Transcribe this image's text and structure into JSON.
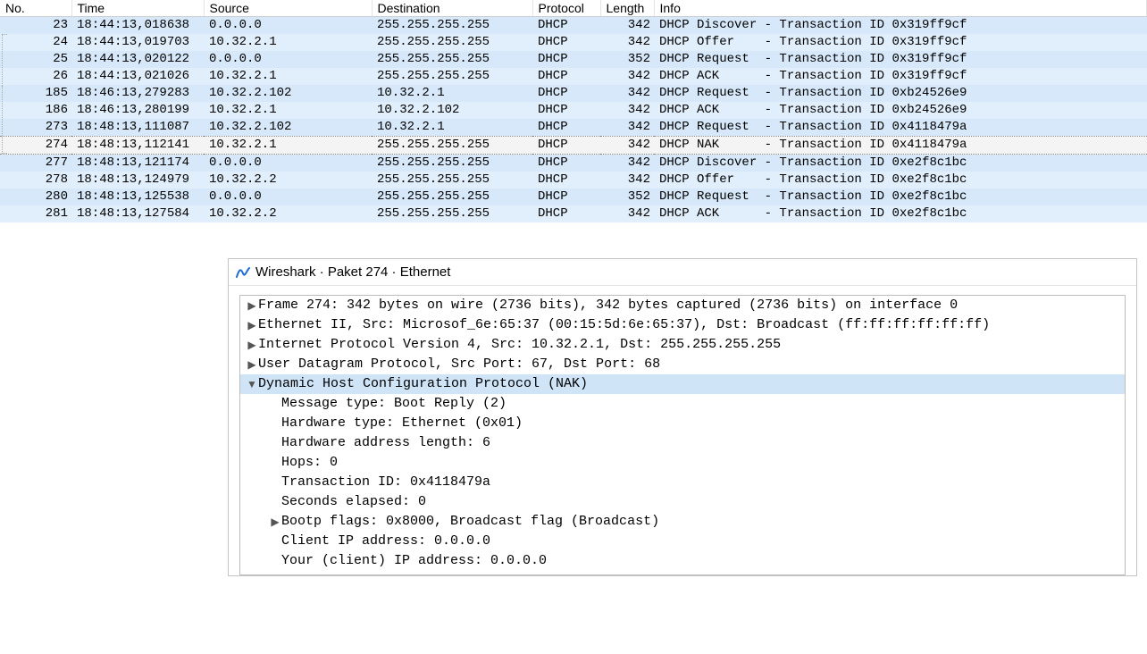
{
  "columns": {
    "no": "No.",
    "time": "Time",
    "source": "Source",
    "destination": "Destination",
    "protocol": "Protocol",
    "length": "Length",
    "info": "Info"
  },
  "packets": [
    {
      "no": "23",
      "time": "18:44:13,018638",
      "src": "0.0.0.0",
      "dst": "255.255.255.255",
      "proto": "DHCP",
      "len": "342",
      "info": "DHCP Discover - Transaction ID 0x319ff9cf",
      "alt": false,
      "sel": false
    },
    {
      "no": "24",
      "time": "18:44:13,019703",
      "src": "10.32.2.1",
      "dst": "255.255.255.255",
      "proto": "DHCP",
      "len": "342",
      "info": "DHCP Offer    - Transaction ID 0x319ff9cf",
      "alt": true,
      "sel": false
    },
    {
      "no": "25",
      "time": "18:44:13,020122",
      "src": "0.0.0.0",
      "dst": "255.255.255.255",
      "proto": "DHCP",
      "len": "352",
      "info": "DHCP Request  - Transaction ID 0x319ff9cf",
      "alt": false,
      "sel": false
    },
    {
      "no": "26",
      "time": "18:44:13,021026",
      "src": "10.32.2.1",
      "dst": "255.255.255.255",
      "proto": "DHCP",
      "len": "342",
      "info": "DHCP ACK      - Transaction ID 0x319ff9cf",
      "alt": true,
      "sel": false
    },
    {
      "no": "185",
      "time": "18:46:13,279283",
      "src": "10.32.2.102",
      "dst": "10.32.2.1",
      "proto": "DHCP",
      "len": "342",
      "info": "DHCP Request  - Transaction ID 0xb24526e9",
      "alt": false,
      "sel": false
    },
    {
      "no": "186",
      "time": "18:46:13,280199",
      "src": "10.32.2.1",
      "dst": "10.32.2.102",
      "proto": "DHCP",
      "len": "342",
      "info": "DHCP ACK      - Transaction ID 0xb24526e9",
      "alt": true,
      "sel": false
    },
    {
      "no": "273",
      "time": "18:48:13,111087",
      "src": "10.32.2.102",
      "dst": "10.32.2.1",
      "proto": "DHCP",
      "len": "342",
      "info": "DHCP Request  - Transaction ID 0x4118479a",
      "alt": false,
      "sel": false
    },
    {
      "no": "274",
      "time": "18:48:13,112141",
      "src": "10.32.2.1",
      "dst": "255.255.255.255",
      "proto": "DHCP",
      "len": "342",
      "info": "DHCP NAK      - Transaction ID 0x4118479a",
      "alt": false,
      "sel": true
    },
    {
      "no": "277",
      "time": "18:48:13,121174",
      "src": "0.0.0.0",
      "dst": "255.255.255.255",
      "proto": "DHCP",
      "len": "342",
      "info": "DHCP Discover - Transaction ID 0xe2f8c1bc",
      "alt": false,
      "sel": false
    },
    {
      "no": "278",
      "time": "18:48:13,124979",
      "src": "10.32.2.2",
      "dst": "255.255.255.255",
      "proto": "DHCP",
      "len": "342",
      "info": "DHCP Offer    - Transaction ID 0xe2f8c1bc",
      "alt": true,
      "sel": false
    },
    {
      "no": "280",
      "time": "18:48:13,125538",
      "src": "0.0.0.0",
      "dst": "255.255.255.255",
      "proto": "DHCP",
      "len": "352",
      "info": "DHCP Request  - Transaction ID 0xe2f8c1bc",
      "alt": false,
      "sel": false
    },
    {
      "no": "281",
      "time": "18:48:13,127584",
      "src": "10.32.2.2",
      "dst": "255.255.255.255",
      "proto": "DHCP",
      "len": "342",
      "info": "DHCP ACK      - Transaction ID 0xe2f8c1bc",
      "alt": true,
      "sel": false
    }
  ],
  "detail": {
    "title": "Wireshark · Paket 274 · Ethernet",
    "rows": [
      {
        "caret": "▶",
        "text": "Frame 274: 342 bytes on wire (2736 bits), 342 bytes captured (2736 bits) on interface 0",
        "sel": false,
        "indent": 0
      },
      {
        "caret": "▶",
        "text": "Ethernet II, Src: Microsof_6e:65:37 (00:15:5d:6e:65:37), Dst: Broadcast (ff:ff:ff:ff:ff:ff)",
        "sel": false,
        "indent": 0
      },
      {
        "caret": "▶",
        "text": "Internet Protocol Version 4, Src: 10.32.2.1, Dst: 255.255.255.255",
        "sel": false,
        "indent": 0
      },
      {
        "caret": "▶",
        "text": "User Datagram Protocol, Src Port: 67, Dst Port: 68",
        "sel": false,
        "indent": 0
      },
      {
        "caret": "▼",
        "text": "Dynamic Host Configuration Protocol (NAK)",
        "sel": true,
        "indent": 0
      },
      {
        "caret": "",
        "text": "Message type: Boot Reply (2)",
        "sel": false,
        "indent": 1
      },
      {
        "caret": "",
        "text": "Hardware type: Ethernet (0x01)",
        "sel": false,
        "indent": 1
      },
      {
        "caret": "",
        "text": "Hardware address length: 6",
        "sel": false,
        "indent": 1
      },
      {
        "caret": "",
        "text": "Hops: 0",
        "sel": false,
        "indent": 1
      },
      {
        "caret": "",
        "text": "Transaction ID: 0x4118479a",
        "sel": false,
        "indent": 1
      },
      {
        "caret": "",
        "text": "Seconds elapsed: 0",
        "sel": false,
        "indent": 1
      },
      {
        "caret": "▶",
        "text": "Bootp flags: 0x8000, Broadcast flag (Broadcast)",
        "sel": false,
        "indent": 1
      },
      {
        "caret": "",
        "text": "Client IP address: 0.0.0.0",
        "sel": false,
        "indent": 1
      },
      {
        "caret": "",
        "text": "Your (client) IP address: 0.0.0.0",
        "sel": false,
        "indent": 1
      }
    ]
  }
}
